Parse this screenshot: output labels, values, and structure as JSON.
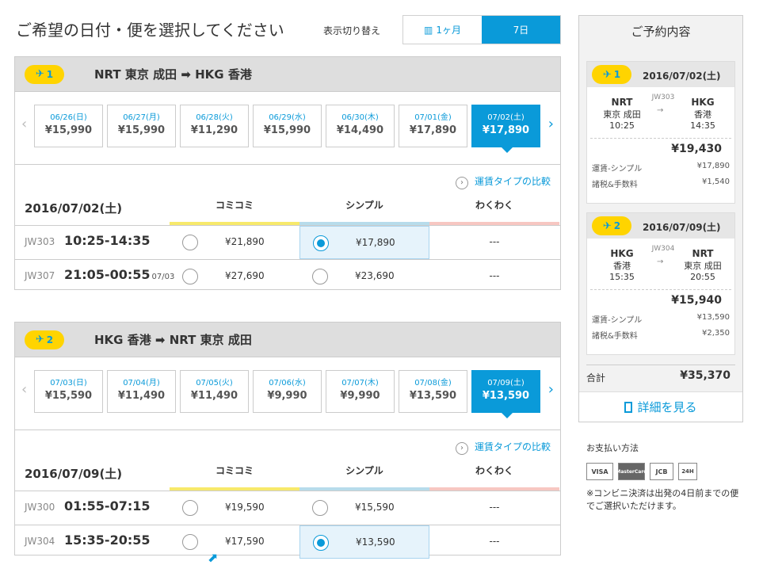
{
  "header": {
    "title": "ご希望の日付・便を選択してください",
    "view_switch_label": "表示切り替え",
    "toggle_month": "1ヶ月",
    "toggle_week": "7日"
  },
  "legs": [
    {
      "badge": "1",
      "route": "NRT 東京 成田 ➡ HKG 香港",
      "dates": [
        {
          "date": "06/26(日)",
          "price": "¥15,990"
        },
        {
          "date": "06/27(月)",
          "price": "¥15,990"
        },
        {
          "date": "06/28(火)",
          "price": "¥11,290"
        },
        {
          "date": "06/29(水)",
          "price": "¥15,990"
        },
        {
          "date": "06/30(木)",
          "price": "¥14,490"
        },
        {
          "date": "07/01(金)",
          "price": "¥17,890"
        },
        {
          "date": "07/02(土)",
          "price": "¥17,890"
        }
      ],
      "compare": "運賃タイプの比較",
      "day": "2016/07/02(土)",
      "fare_types": [
        "コミコミ",
        "シンプル",
        "わくわく"
      ],
      "flights": [
        {
          "no": "JW303",
          "time": "10:25-14:35",
          "next": "",
          "komikomi": "¥21,890",
          "simple": "¥17,890",
          "wakuwaku": "---"
        },
        {
          "no": "JW307",
          "time": "21:05-00:55",
          "next": "07/03",
          "komikomi": "¥27,690",
          "simple": "¥23,690",
          "wakuwaku": "---"
        }
      ]
    },
    {
      "badge": "2",
      "route": "HKG 香港 ➡ NRT 東京 成田",
      "dates": [
        {
          "date": "07/03(日)",
          "price": "¥15,590"
        },
        {
          "date": "07/04(月)",
          "price": "¥11,490"
        },
        {
          "date": "07/05(火)",
          "price": "¥11,490"
        },
        {
          "date": "07/06(水)",
          "price": "¥9,990"
        },
        {
          "date": "07/07(木)",
          "price": "¥9,990"
        },
        {
          "date": "07/08(金)",
          "price": "¥13,590"
        },
        {
          "date": "07/09(土)",
          "price": "¥13,590"
        }
      ],
      "compare": "運賃タイプの比較",
      "day": "2016/07/09(土)",
      "fare_types": [
        "コミコミ",
        "シンプル",
        "わくわく"
      ],
      "flights": [
        {
          "no": "JW300",
          "time": "01:55-07:15",
          "next": "",
          "komikomi": "¥19,590",
          "simple": "¥15,590",
          "wakuwaku": "---"
        },
        {
          "no": "JW304",
          "time": "15:35-20:55",
          "next": "",
          "komikomi": "¥17,590",
          "simple": "¥13,590",
          "wakuwaku": "---"
        }
      ]
    }
  ],
  "summary": {
    "title": "ご予約内容",
    "legs": [
      {
        "badge": "1",
        "date": "2016/07/02(土)",
        "from_code": "NRT",
        "from_name": "東京 成田",
        "from_time": "10:25",
        "flight": "JW303",
        "to_code": "HKG",
        "to_name": "香港",
        "to_time": "14:35",
        "total": "¥19,430",
        "fare_label": "運賃-シンプル",
        "fare": "¥17,890",
        "tax_label": "諸税&手数料",
        "tax": "¥1,540"
      },
      {
        "badge": "2",
        "date": "2016/07/09(土)",
        "from_code": "HKG",
        "from_name": "香港",
        "from_time": "15:35",
        "flight": "JW304",
        "to_code": "NRT",
        "to_name": "東京 成田",
        "to_time": "20:55",
        "total": "¥15,940",
        "fare_label": "運賃-シンプル",
        "fare": "¥13,590",
        "tax_label": "諸税&手数料",
        "tax": "¥2,350"
      }
    ],
    "grand_total_label": "合計",
    "grand_total": "¥35,370",
    "detail_link": "詳細を見る"
  },
  "payment": {
    "label": "お支払い方法",
    "cards": [
      "VISA",
      "MasterCard",
      "JCB",
      "24H"
    ],
    "note": "※コンビニ決済は出発の4日前までの便でご選択いただけます。"
  },
  "colors": {
    "accent": "#0a9ad9",
    "badge": "#ffd400",
    "komikomi": "#f7e96b",
    "simple": "#b7dceb",
    "wakuwaku": "#f7c7c2"
  }
}
